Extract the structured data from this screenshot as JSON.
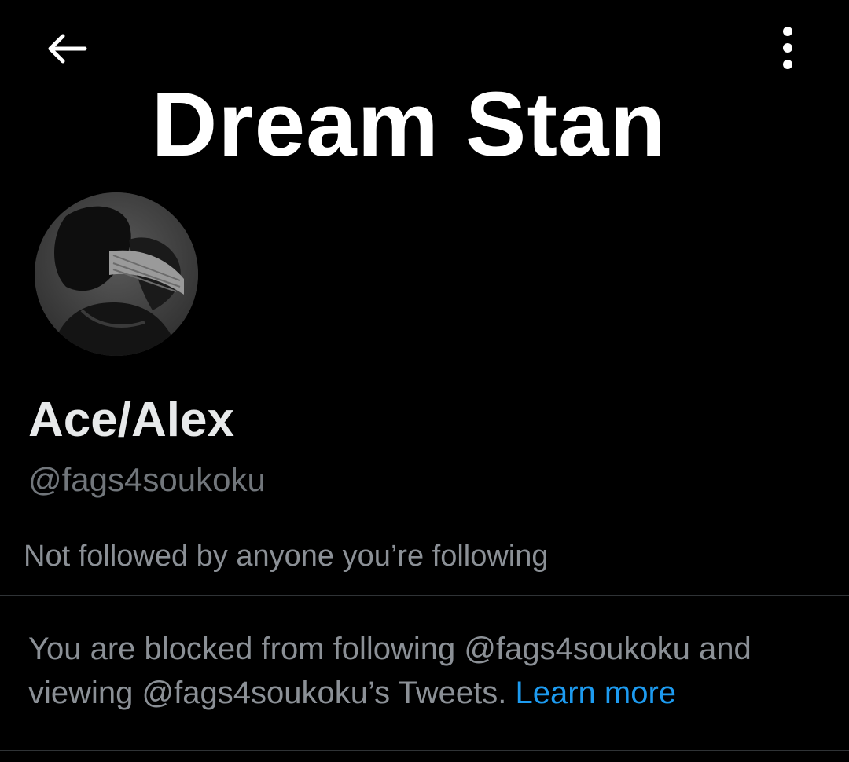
{
  "header": {
    "back_icon": "arrow-left-icon",
    "more_icon": "more-vertical-icon"
  },
  "banner": {
    "text": "Dream Stan",
    "background": "#000000"
  },
  "profile": {
    "display_name": "Ace/Alex",
    "handle": "@fags4soukoku",
    "followed_by": "Not followed by anyone you’re following"
  },
  "blocked_notice": {
    "line1": "You are blocked from following @fags4soukoku and",
    "line2": "viewing @fags4soukoku’s Tweets.",
    "link_label": "Learn more"
  },
  "colors": {
    "background": "#000000",
    "primary_text": "#e7e9ea",
    "secondary_text": "#71767b",
    "link": "#1d9bf0",
    "divider": "#2f3336"
  }
}
